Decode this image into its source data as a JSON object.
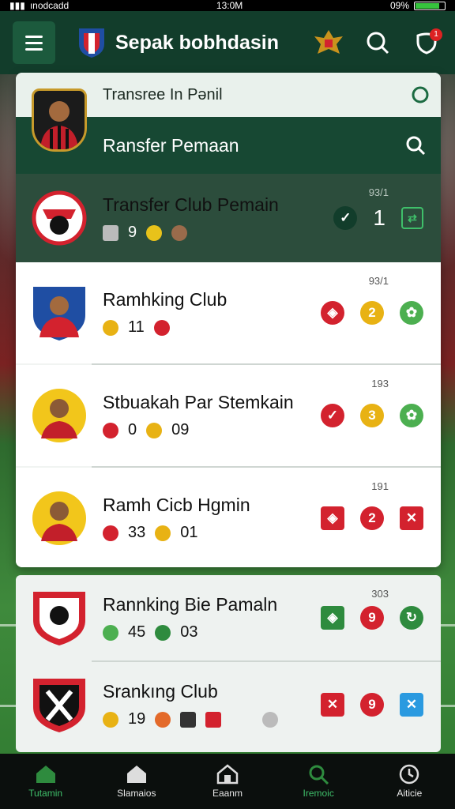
{
  "status_bar": {
    "carrier": "ınodcadd",
    "time": "13:0M",
    "battery": "09%"
  },
  "header": {
    "title": "Sepak bobhdasin",
    "notification_count": "1"
  },
  "panel": {
    "top_title": "Transree In Pənil",
    "search_band_title": "Ransfer Pemaan"
  },
  "rows": [
    {
      "title": "Transfer Club Pemain",
      "meta": [
        "9"
      ],
      "rank_small": "93/1",
      "action_value": "1"
    },
    {
      "title": "Ramhking Club",
      "meta": [
        "11"
      ],
      "rank_small": "93/1",
      "action_value": "2"
    },
    {
      "title": "Stbuakah Par Stemkain",
      "meta": [
        "0",
        "09"
      ],
      "rank_small": "193",
      "action_value": "3"
    },
    {
      "title": "Ramh Cicb Hgmin",
      "meta": [
        "33",
        "01"
      ],
      "rank_small": "191",
      "action_value": "2"
    }
  ],
  "lower_rows": [
    {
      "title": "Rannking Bie Pamaln",
      "meta": [
        "45",
        "03"
      ],
      "rank_small": "303",
      "action_value": "9"
    },
    {
      "title": "Srankıng Club",
      "meta": [
        "19"
      ],
      "action_value": "9"
    }
  ],
  "bottom_nav": [
    {
      "label": "Tutamin",
      "icon": "home-icon",
      "active": true
    },
    {
      "label": "Slamaios",
      "icon": "club-icon",
      "active": false
    },
    {
      "label": "Eaanm",
      "icon": "building-icon",
      "active": false
    },
    {
      "label": "Iremoic",
      "icon": "search-icon",
      "active": true
    },
    {
      "label": "Aiticie",
      "icon": "clock-icon",
      "active": false
    }
  ],
  "colors": {
    "header_bg": "#123d2b",
    "band_bg": "#174833",
    "accent_green": "#3fbf6a",
    "red": "#d3222e",
    "gold": "#e8b214"
  }
}
